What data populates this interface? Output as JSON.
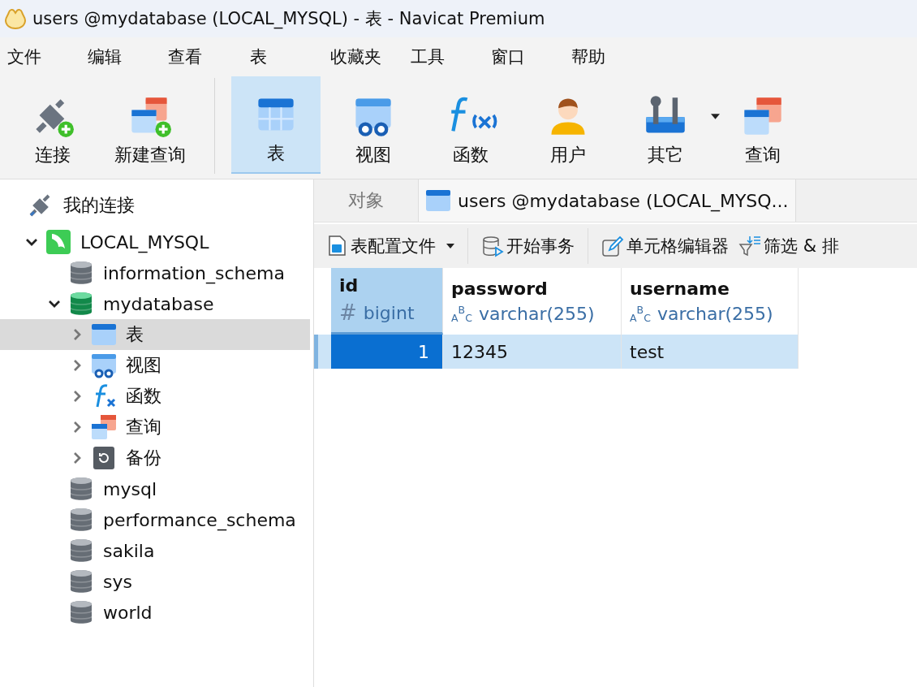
{
  "window": {
    "title": "users @mydatabase (LOCAL_MYSQL) - 表 - Navicat Premium"
  },
  "menu": [
    "文件",
    "编辑",
    "查看",
    "表",
    "收藏夹",
    "工具",
    "窗口",
    "帮助"
  ],
  "toolbar": [
    {
      "label": "连接",
      "kind": "connect",
      "selected": false
    },
    {
      "label": "新建查询",
      "kind": "new-query",
      "selected": false
    },
    {
      "label": "表",
      "kind": "table",
      "selected": true
    },
    {
      "label": "视图",
      "kind": "view",
      "selected": false
    },
    {
      "label": "函数",
      "kind": "function",
      "selected": false
    },
    {
      "label": "用户",
      "kind": "user",
      "selected": false
    },
    {
      "label": "其它",
      "kind": "tools",
      "selected": false,
      "dropdown": true
    },
    {
      "label": "查询",
      "kind": "query",
      "selected": false
    }
  ],
  "sidebar": {
    "header": "我的连接",
    "tree": [
      {
        "label": "LOCAL_MYSQL",
        "kind": "mysql",
        "expanded": true,
        "selected": false,
        "children": [
          {
            "label": "information_schema",
            "kind": "database",
            "open": false,
            "selected": false
          },
          {
            "label": "mydatabase",
            "kind": "database",
            "open": true,
            "expanded": true,
            "selected": false,
            "children": [
              {
                "label": "表",
                "kind": "table",
                "expanded": false,
                "selected": true
              },
              {
                "label": "视图",
                "kind": "view",
                "expanded": false,
                "selected": false
              },
              {
                "label": "函数",
                "kind": "function",
                "expanded": false,
                "selected": false
              },
              {
                "label": "查询",
                "kind": "query",
                "expanded": false,
                "selected": false
              },
              {
                "label": "备份",
                "kind": "backup",
                "expanded": false,
                "selected": false
              }
            ]
          },
          {
            "label": "mysql",
            "kind": "database",
            "open": false,
            "selected": false
          },
          {
            "label": "performance_schema",
            "kind": "database",
            "open": false,
            "selected": false
          },
          {
            "label": "sakila",
            "kind": "database",
            "open": false,
            "selected": false
          },
          {
            "label": "sys",
            "kind": "database",
            "open": false,
            "selected": false
          },
          {
            "label": "world",
            "kind": "database",
            "open": false,
            "selected": false
          }
        ]
      }
    ]
  },
  "tabs": [
    {
      "label": "对象",
      "selected": false,
      "kind": "plain"
    },
    {
      "label": "users @mydatabase (LOCAL_MYSQ...",
      "selected": true,
      "kind": "table"
    }
  ],
  "table_toolbar": [
    {
      "label": "表配置文件",
      "kind": "profile",
      "dropdown": true
    },
    {
      "label": "开始事务",
      "kind": "transaction"
    },
    {
      "label": "单元格编辑器",
      "kind": "edit"
    },
    {
      "label": "筛选 & 排",
      "kind": "filter"
    }
  ],
  "table": {
    "columns": [
      {
        "name": "id",
        "type_mark": "#",
        "type": "bigint",
        "kind": "number",
        "selected": true
      },
      {
        "name": "password",
        "type_mark": "$_{A}$$^{B}$$_{C}$",
        "type": "varchar(255)",
        "kind": "text",
        "selected": false
      },
      {
        "name": "username",
        "type_mark": "$_{A}$$^{B}$$_{C}$",
        "type": "varchar(255)",
        "kind": "text",
        "selected": false
      }
    ],
    "rows": [
      {
        "cells": [
          "1",
          "12345",
          "test"
        ],
        "selected": true
      }
    ]
  }
}
